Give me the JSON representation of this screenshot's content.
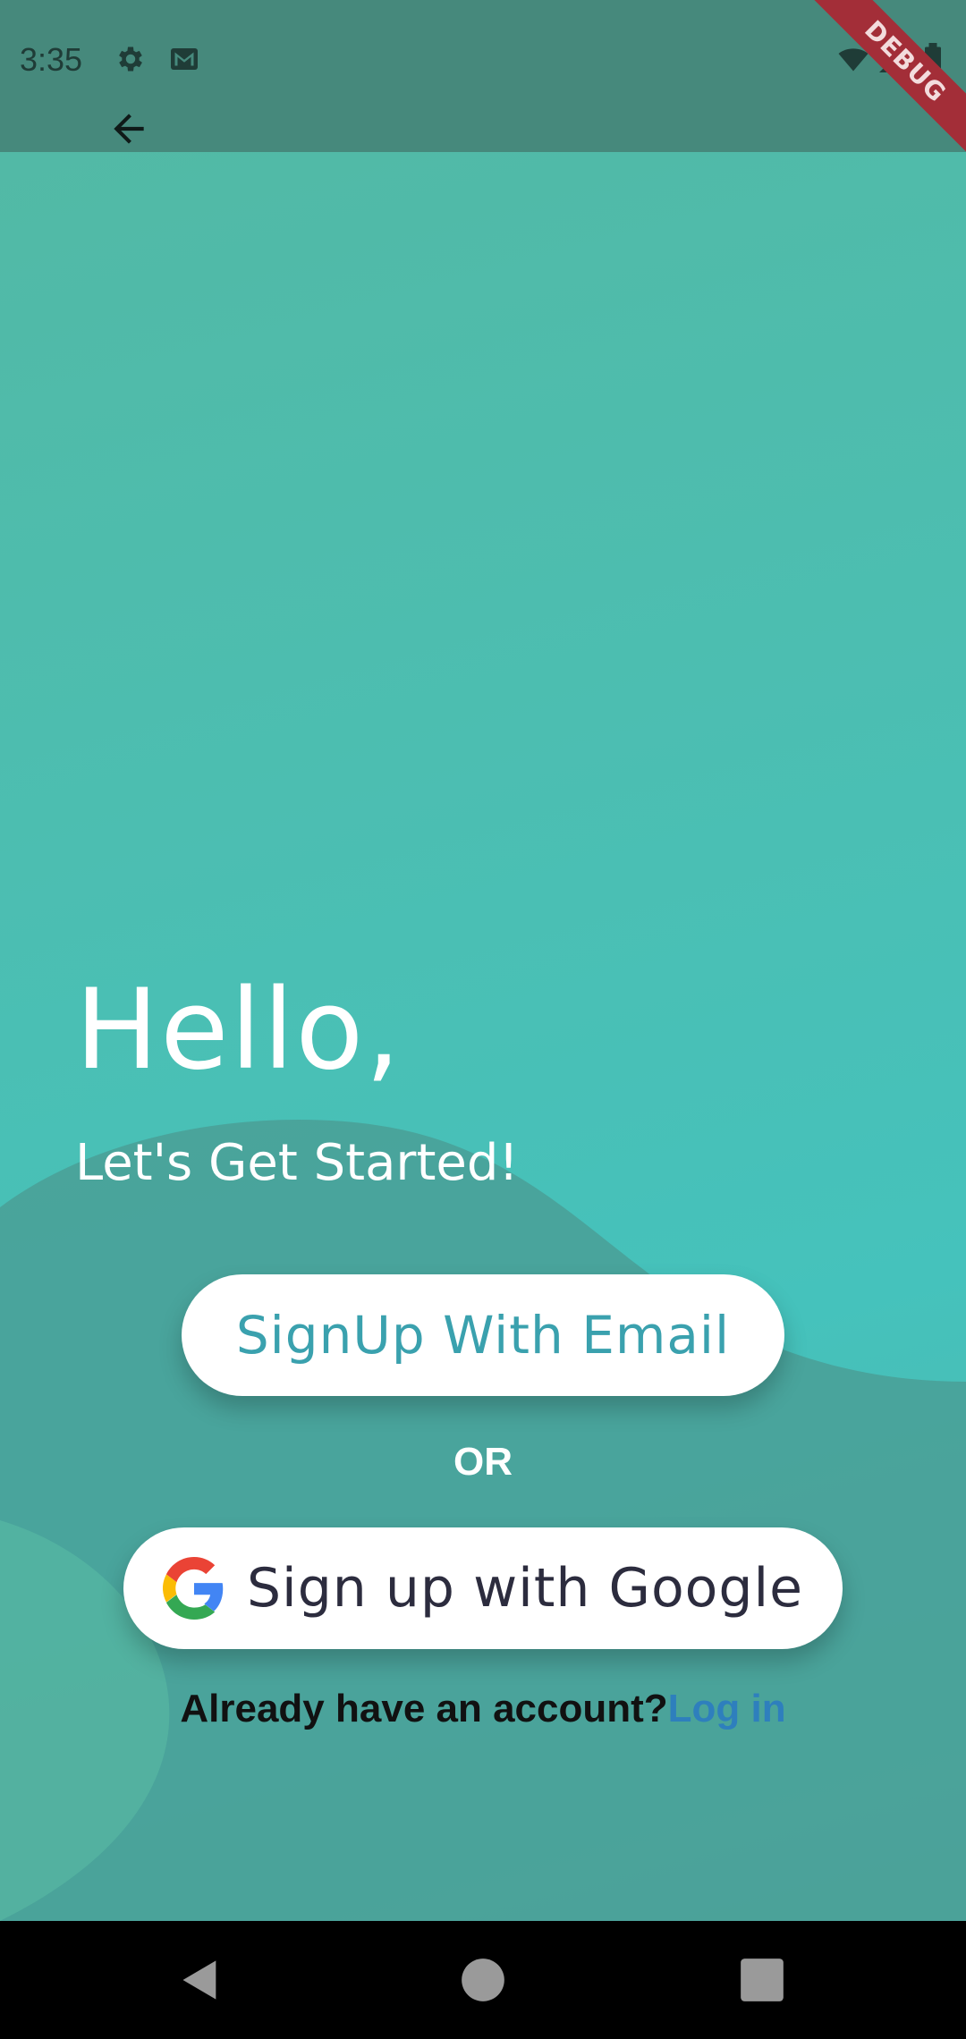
{
  "status_bar": {
    "time": "3:35",
    "icons": [
      "gear-icon",
      "gmail-icon",
      "wifi-icon",
      "signal-icon",
      "battery-icon"
    ]
  },
  "app_bar": {
    "back_icon": "arrow-left-icon",
    "debug_banner": "DEBUG"
  },
  "main": {
    "greeting": "Hello,",
    "subtitle": "Let's Get Started!",
    "email_button": "SignUp With Email",
    "or_label": "OR",
    "google_button": "Sign up with Google",
    "login_prompt": "Already have an account?",
    "login_link": "Log in"
  },
  "nav_bar": {
    "icons": [
      "back-triangle-icon",
      "home-circle-icon",
      "recents-square-icon"
    ]
  },
  "colors": {
    "background": "#4cbeb1",
    "status_bar": "#46897c",
    "email_text": "#3aa1ae",
    "link": "#2e7fbd",
    "debug_banner": "#a32e38"
  }
}
